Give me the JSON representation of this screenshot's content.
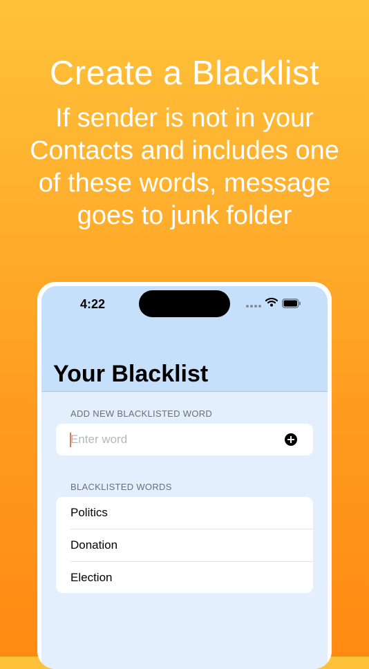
{
  "promo": {
    "headline": "Create a Blacklist",
    "subline_lines": [
      "If sender is not in your",
      "Contacts and includes one",
      "of these words, message",
      "goes to junk folder"
    ]
  },
  "status_bar": {
    "time": "4:22",
    "icons": [
      "signal-icon",
      "wifi-icon",
      "battery-icon"
    ]
  },
  "screen": {
    "title": "Your Blacklist",
    "add_section": {
      "label": "ADD NEW BLACKLISTED WORD",
      "input_value": "",
      "input_placeholder": "Enter word",
      "add_icon": "plus-circle-icon"
    },
    "list_section": {
      "label": "BLACKLISTED WORDS",
      "items": [
        "Politics",
        "Donation",
        "Election"
      ]
    }
  },
  "colors": {
    "background_top": "#FFC23A",
    "background_bottom": "#FF8A12",
    "navbar": "#C6E0FB",
    "screen_background": "#E3EFFD",
    "caret": "#E07A56"
  }
}
